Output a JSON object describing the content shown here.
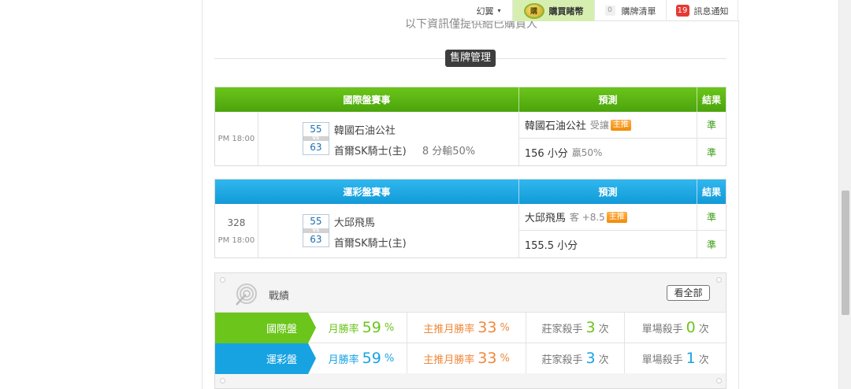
{
  "topbar": {
    "user_label": "幻翼",
    "user_caret": "▾",
    "buy_icon_text": "購",
    "buy_label": "購買睹幣",
    "cart_count": "0",
    "cart_label": "購牌清單",
    "msg_count": "19",
    "msg_label": "訊息通知"
  },
  "clipped_notice": "以下資訊僅提供給已購買人",
  "section_label": "售牌管理",
  "intl": {
    "head_game": "國際盤賽事",
    "head_pred": "預測",
    "head_result": "結果",
    "time": "PM 18:00",
    "score_home": "55",
    "score_away": "63",
    "vs": "VS",
    "team1": "韓國石油公社",
    "team2": "首爾SK騎士(主)",
    "note": "8 分輸50%",
    "pred1_main": "韓國石油公社",
    "pred1_gray": "受讓",
    "pred1_badge": "主推",
    "pred2_main": "156 小分",
    "pred2_gray": "贏50%",
    "res1": "準",
    "res2": "準"
  },
  "sports": {
    "head_game": "運彩盤賽事",
    "head_pred": "預測",
    "head_result": "結果",
    "num": "328",
    "time": "PM 18:00",
    "score_home": "55",
    "score_away": "63",
    "vs": "VS",
    "team1": "大邱飛馬",
    "team2": "首爾SK騎士(主)",
    "pred1_main": "大邱飛馬",
    "pred1_gray": "客 +8.5",
    "pred1_badge": "主推",
    "pred2_main": "155.5 小分",
    "res1": "準",
    "res2": "準"
  },
  "record": {
    "title": "戰績",
    "view_all": "看全部",
    "rows": [
      {
        "label": "國際盤",
        "month_rate_label": "月勝率",
        "month_rate": "59",
        "pct": "%",
        "main_rate_label": "主推月勝率",
        "main_rate": "33",
        "banker_label": "莊家殺手",
        "banker": "3",
        "times": "次",
        "single_label": "單場殺手",
        "single": "0"
      },
      {
        "label": "運彩盤",
        "month_rate_label": "月勝率",
        "month_rate": "59",
        "pct": "%",
        "main_rate_label": "主推月勝率",
        "main_rate": "33",
        "banker_label": "莊家殺手",
        "banker": "3",
        "times": "次",
        "single_label": "單場殺手",
        "single": "1"
      }
    ]
  },
  "colors": {
    "green": "#6cc51a",
    "blue": "#17a3e2",
    "orange": "#f0883a"
  }
}
